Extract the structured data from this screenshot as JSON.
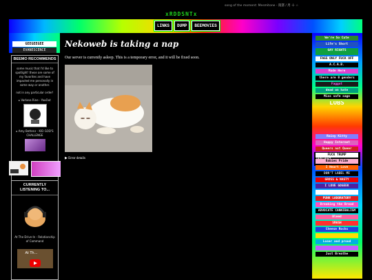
{
  "song": {
    "text": "song of the moment: Mesmitone - 雨潺 / 月 十 ☆"
  },
  "logo": {
    "text": "xRDDSNTx"
  },
  "nav": {
    "links": "LINKS",
    "dump": "DUMP",
    "beemovies": "BEEMOVIES"
  },
  "left": {
    "banners": [
      "GEEGEEGEE",
      "EVANESCENCE"
    ],
    "recommends": {
      "heading": "BEEMO RECOMMENDS",
      "blurb": "some music that I'd like to spotlight! these are some of my favorites and have impacted me personally in some way or another.",
      "note": "not in any particular order!",
      "item1": "▸ Varlana Rine - YouOut",
      "item2": "▸ Amy Bettenz - KID GOD'S CHALLENGE"
    },
    "listening": {
      "heading": "CURRENTLY LISTENING TO...",
      "track": "At The Drive-In - Relationship of Command",
      "video_label": "At Th..."
    }
  },
  "main": {
    "title": "Nekoweb is taking a nap",
    "message": "Our server is currently asleep. This is a temporary error, and it will be fixed soon.",
    "details": "▶ Error details"
  },
  "right": {
    "badges": [
      "We're So Cute",
      "Life's Short",
      "GAY RIGHTS",
      "FAGS ONLY FUCK OFF",
      "A.C.A.B.",
      "Made Here",
      "there are 0 genders",
      "Faggot",
      "dead on hate",
      "Miss safe sage",
      "LOBS"
    ],
    "month": "JANUARY",
    "badges2": [
      "Rainy Kitty",
      "Happy Internet",
      "Queers not Queer",
      "FUCK TRUMP",
      "Babies Pride",
      "I Heart Love",
      "DON'T LABEL ME",
      "GROSS & NASTY",
      "I LOVE GOGEEK",
      "",
      "PUNK LABORATORY",
      "Breaking the Bread",
      "ADVOCATE CANNIBALISM",
      "Bleed",
      "SMASH",
      "Cheese Rocks",
      "",
      "Loser and proud",
      "",
      "Just Breathe"
    ]
  },
  "colors": {
    "accent": "#00ff00",
    "bg": "#000000"
  }
}
